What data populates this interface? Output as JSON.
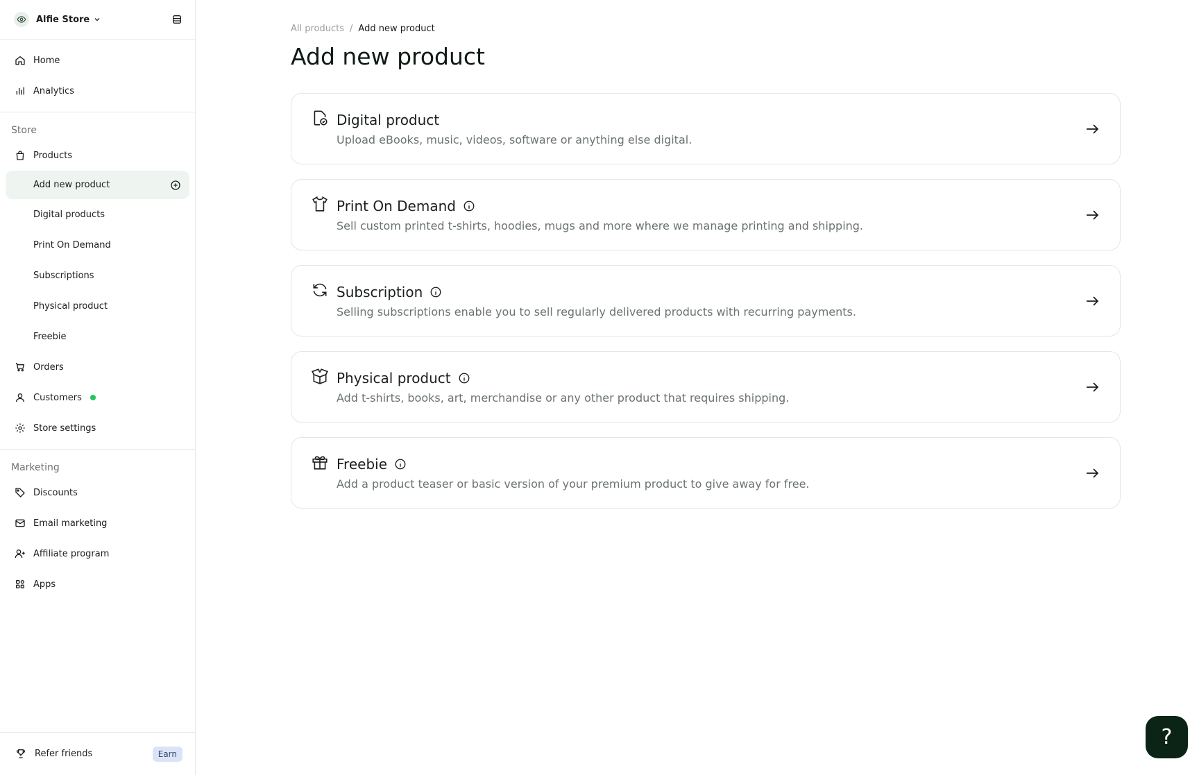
{
  "store": {
    "name": "Alfie Store"
  },
  "nav": {
    "home": "Home",
    "analytics": "Analytics",
    "store_section": "Store",
    "products": "Products",
    "products_sub": [
      "Add new product",
      "Digital products",
      "Print On Demand",
      "Subscriptions",
      "Physical product",
      "Freebie"
    ],
    "orders": "Orders",
    "customers": "Customers",
    "store_settings": "Store settings",
    "marketing_section": "Marketing",
    "discounts": "Discounts",
    "email_marketing": "Email marketing",
    "affiliate_program": "Affiliate program",
    "apps": "Apps",
    "refer_friends": "Refer friends",
    "earn_badge": "Earn"
  },
  "breadcrumb": {
    "parent": "All products",
    "separator": "/",
    "current": "Add new product"
  },
  "page_title": "Add new product",
  "cards": [
    {
      "title": "Digital product",
      "description": "Upload eBooks, music, videos, software or anything else digital.",
      "icon": "digital-file-icon"
    },
    {
      "title": "Print On Demand",
      "description": "Sell custom printed t-shirts, hoodies, mugs and more where we manage printing and shipping.",
      "icon": "tshirt-icon"
    },
    {
      "title": "Subscription",
      "description": "Selling subscriptions enable you to sell regularly delivered products with recurring payments.",
      "icon": "refresh-icon"
    },
    {
      "title": "Physical product",
      "description": "Add t-shirts, books, art, merchandise or any other product that requires shipping.",
      "icon": "open-box-icon"
    },
    {
      "title": "Freebie",
      "description": "Add a product teaser or basic version of your premium product to give away for free.",
      "icon": "gift-icon"
    }
  ],
  "help": {
    "label": "?"
  },
  "colors": {
    "accent_dark": "#0c2416",
    "active_bg": "#eef4ef",
    "online_dot": "#22c55e",
    "earn_bg": "#dbe4f7"
  }
}
